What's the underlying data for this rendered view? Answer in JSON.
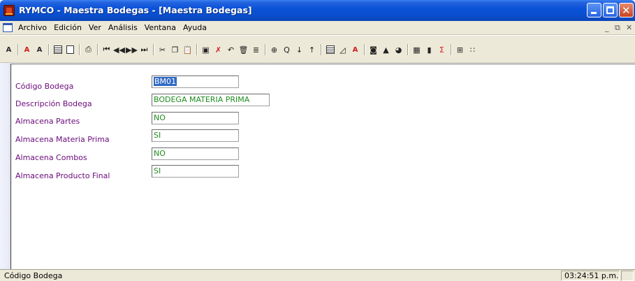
{
  "window": {
    "title": "RYMCO - Maestra Bodegas - [Maestra Bodegas]",
    "controls": {
      "minimize": "minimize",
      "maximize": "maximize",
      "close": "✕"
    }
  },
  "menu": {
    "items": [
      {
        "label": "Archivo"
      },
      {
        "label": "Edición"
      },
      {
        "label": "Ver"
      },
      {
        "label": "Análisis"
      },
      {
        "label": "Ventana"
      },
      {
        "label": "Ayuda"
      }
    ],
    "mdi_min": "_",
    "mdi_restore": "⧉",
    "mdi_close": "✕"
  },
  "toolbar": {
    "icons": [
      "filter-icon",
      "sep",
      "font-red-icon",
      "font-bold-icon",
      "sep",
      "grid-icon",
      "form-icon",
      "sep",
      "print-icon",
      "sep",
      "first-record-icon",
      "previous-record-icon",
      "next-record-icon",
      "last-record-icon",
      "sep",
      "cut-icon",
      "copy-icon",
      "paste-icon",
      "sep",
      "save-icon",
      "cancel-icon",
      "undo-icon",
      "delete-icon",
      "list-icon",
      "sep",
      "zoom-in-icon",
      "zoom-out-icon",
      "sort-ascending-icon",
      "sort-descending-icon",
      "sep",
      "table-icon",
      "chart-area-icon",
      "color-font-icon",
      "sep",
      "camera-icon",
      "landscape-icon",
      "pie-icon",
      "sep",
      "calculator-icon",
      "bar-chart-icon",
      "sum-icon",
      "sep",
      "tree-icon",
      "more-icon"
    ]
  },
  "form": {
    "fields": [
      {
        "label": "Código Bodega",
        "value": "BM01"
      },
      {
        "label": "Descripción Bodega",
        "value": "BODEGA MATERIA PRIMA"
      },
      {
        "label": "Almacena Partes",
        "value": "NO"
      },
      {
        "label": "Almacena Materia Prima",
        "value": "SI"
      },
      {
        "label": "Almacena Combos",
        "value": "NO"
      },
      {
        "label": "Almacena Producto Final",
        "value": "SI"
      }
    ]
  },
  "status": {
    "message": "Código Bodega",
    "time": "03:24:51 p.m."
  },
  "colors": {
    "title_bar": "#0a52d8",
    "label_text": "#6a0a7a",
    "field_text": "#1f8c1f",
    "selection": "#316ac5"
  }
}
